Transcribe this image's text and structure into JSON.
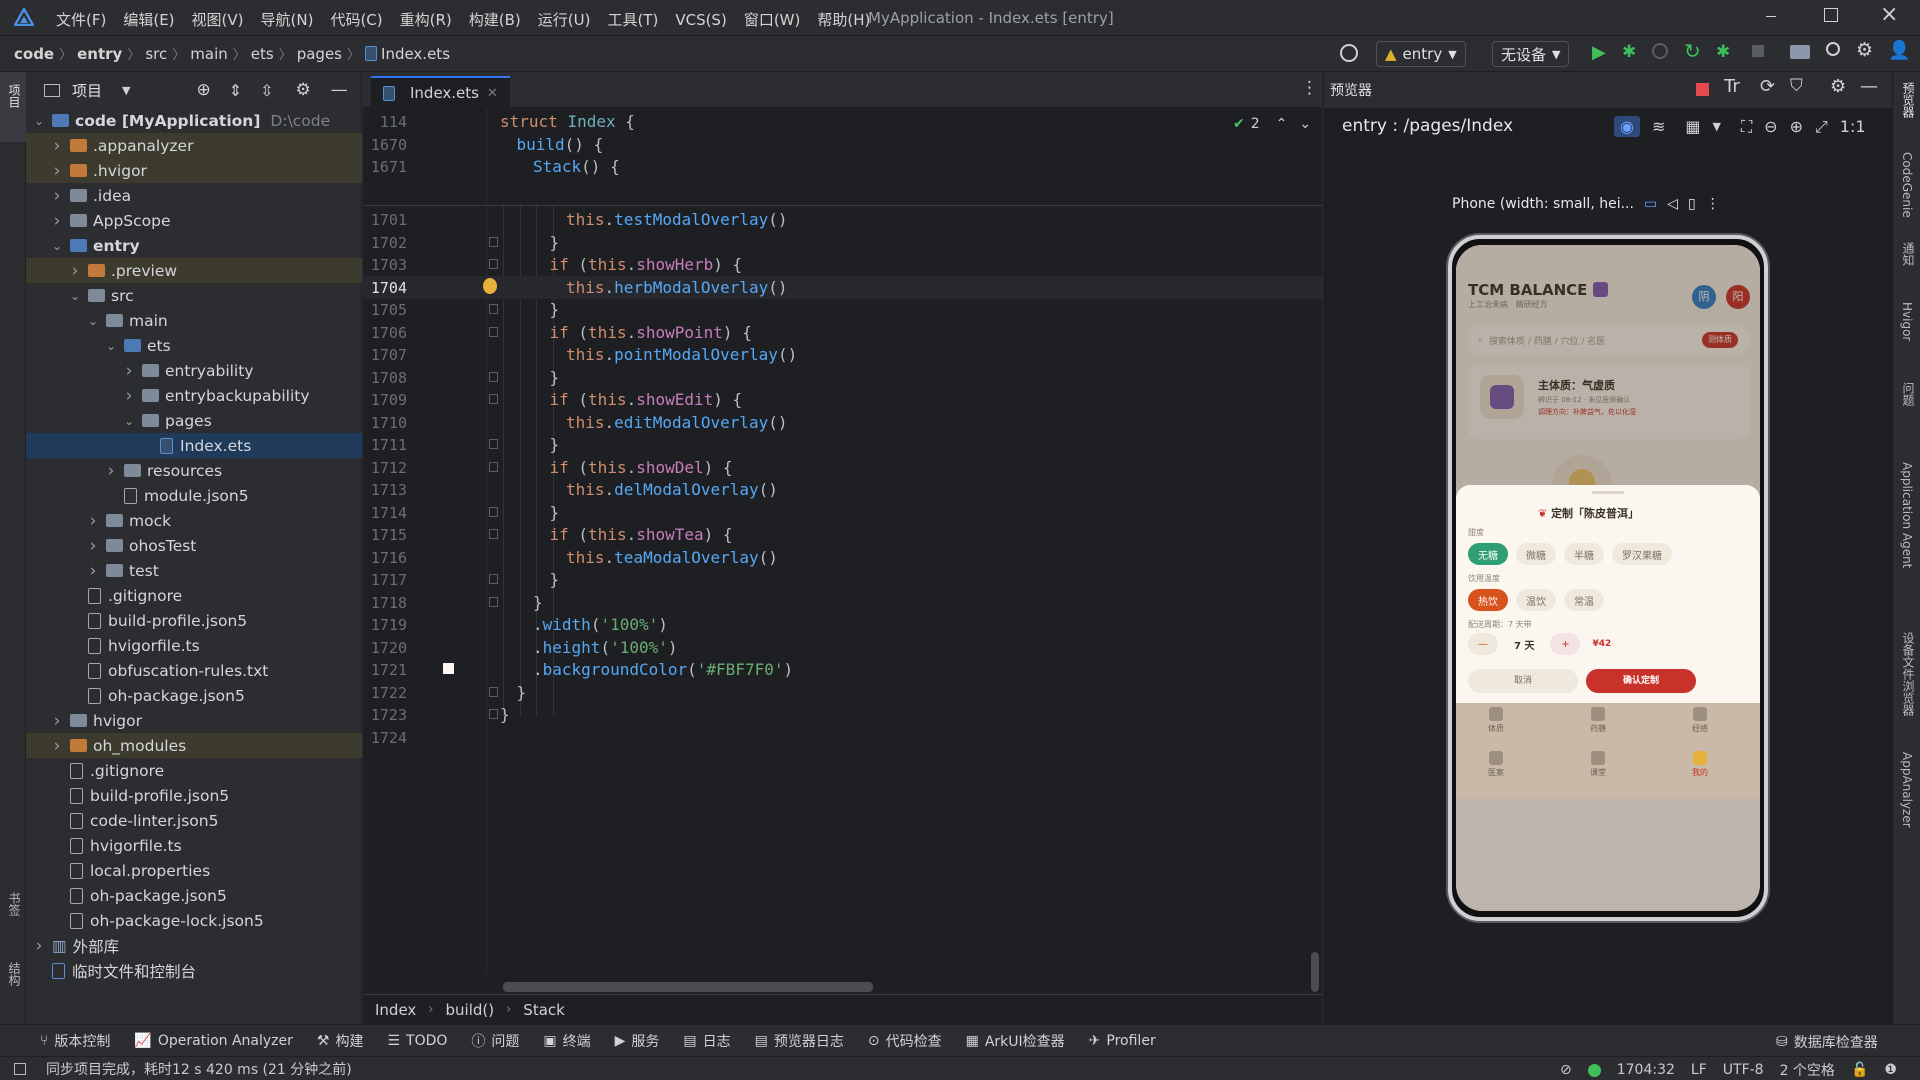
{
  "menu": [
    "文件(F)",
    "编辑(E)",
    "视图(V)",
    "导航(N)",
    "代码(C)",
    "重构(R)",
    "构建(B)",
    "运行(U)",
    "工具(T)",
    "VCS(S)",
    "窗口(W)",
    "帮助(H)"
  ],
  "window_title": "MyApplication - Index.ets [entry]",
  "breadcrumb": [
    "code",
    "entry",
    "src",
    "main",
    "ets",
    "pages",
    "Index.ets"
  ],
  "run_config": "entry",
  "device": "无设备",
  "left_strip": {
    "project": "项目",
    "bookmarks": "书签",
    "structure": "结构"
  },
  "project_panel": {
    "title": "项目"
  },
  "tree": [
    {
      "label": "code [MyApplication]",
      "extra": "D:\\code",
      "depth": 0,
      "arrow": "v",
      "type": "root",
      "bold": true
    },
    {
      "label": ".appanalyzer",
      "depth": 1,
      "arrow": ">",
      "type": "folder-orange",
      "hl": true
    },
    {
      "label": ".hvigor",
      "depth": 1,
      "arrow": ">",
      "type": "folder-orange",
      "hl": true
    },
    {
      "label": ".idea",
      "depth": 1,
      "arrow": ">",
      "type": "folder"
    },
    {
      "label": "AppScope",
      "depth": 1,
      "arrow": ">",
      "type": "folder"
    },
    {
      "label": "entry",
      "depth": 1,
      "arrow": "v",
      "type": "folder-blue",
      "bold": true
    },
    {
      "label": ".preview",
      "depth": 2,
      "arrow": ">",
      "type": "folder-orange",
      "hl": true
    },
    {
      "label": "src",
      "depth": 2,
      "arrow": "v",
      "type": "folder"
    },
    {
      "label": "main",
      "depth": 3,
      "arrow": "v",
      "type": "folder"
    },
    {
      "label": "ets",
      "depth": 4,
      "arrow": "v",
      "type": "folder-blue"
    },
    {
      "label": "entryability",
      "depth": 5,
      "arrow": ">",
      "type": "folder"
    },
    {
      "label": "entrybackupability",
      "depth": 5,
      "arrow": ">",
      "type": "folder"
    },
    {
      "label": "pages",
      "depth": 5,
      "arrow": "v",
      "type": "folder"
    },
    {
      "label": "Index.ets",
      "depth": 6,
      "arrow": "",
      "type": "ets",
      "sel": true
    },
    {
      "label": "resources",
      "depth": 4,
      "arrow": ">",
      "type": "folder"
    },
    {
      "label": "module.json5",
      "depth": 4,
      "arrow": "",
      "type": "file"
    },
    {
      "label": "mock",
      "depth": 3,
      "arrow": ">",
      "type": "folder"
    },
    {
      "label": "ohosTest",
      "depth": 3,
      "arrow": ">",
      "type": "folder"
    },
    {
      "label": "test",
      "depth": 3,
      "arrow": ">",
      "type": "folder"
    },
    {
      "label": ".gitignore",
      "depth": 2,
      "arrow": "",
      "type": "file"
    },
    {
      "label": "build-profile.json5",
      "depth": 2,
      "arrow": "",
      "type": "file"
    },
    {
      "label": "hvigorfile.ts",
      "depth": 2,
      "arrow": "",
      "type": "file"
    },
    {
      "label": "obfuscation-rules.txt",
      "depth": 2,
      "arrow": "",
      "type": "file"
    },
    {
      "label": "oh-package.json5",
      "depth": 2,
      "arrow": "",
      "type": "file"
    },
    {
      "label": "hvigor",
      "depth": 1,
      "arrow": ">",
      "type": "folder"
    },
    {
      "label": "oh_modules",
      "depth": 1,
      "arrow": ">",
      "type": "folder-orange",
      "hl": true
    },
    {
      "label": ".gitignore",
      "depth": 1,
      "arrow": "",
      "type": "file"
    },
    {
      "label": "build-profile.json5",
      "depth": 1,
      "arrow": "",
      "type": "file"
    },
    {
      "label": "code-linter.json5",
      "depth": 1,
      "arrow": "",
      "type": "file"
    },
    {
      "label": "hvigorfile.ts",
      "depth": 1,
      "arrow": "",
      "type": "file"
    },
    {
      "label": "local.properties",
      "depth": 1,
      "arrow": "",
      "type": "file"
    },
    {
      "label": "oh-package.json5",
      "depth": 1,
      "arrow": "",
      "type": "file"
    },
    {
      "label": "oh-package-lock.json5",
      "depth": 1,
      "arrow": "",
      "type": "file"
    },
    {
      "label": "外部库",
      "depth": 0,
      "arrow": ">",
      "type": "lib"
    },
    {
      "label": "临时文件和控制台",
      "depth": 0,
      "arrow": "",
      "type": "scratch"
    }
  ],
  "editor": {
    "tab": "Index.ets",
    "inspections": "2",
    "sticky": [
      {
        "ln": "114",
        "parts": [
          [
            "kw",
            "struct "
          ],
          [
            "ty",
            "Index "
          ],
          [
            "",
            "{"
          ]
        ],
        "indent": 0
      },
      {
        "ln": "1670",
        "parts": [
          [
            "fn",
            "build"
          ],
          [
            "",
            "() {"
          ]
        ],
        "indent": 1
      },
      {
        "ln": "1671",
        "parts": [
          [
            "fn",
            "Stack"
          ],
          [
            "",
            "() {"
          ]
        ],
        "indent": 2
      }
    ],
    "lines": [
      {
        "ln": "1701",
        "parts": [
          [
            "th",
            "this"
          ],
          [
            "",
            "."
          ],
          [
            "fn",
            "testModalOverlay"
          ],
          [
            "",
            "()"
          ]
        ],
        "indent": 4
      },
      {
        "ln": "1702",
        "parts": [
          [
            "",
            "}"
          ]
        ],
        "indent": 3
      },
      {
        "ln": "1703",
        "parts": [
          [
            "kw",
            "if "
          ],
          [
            "",
            "("
          ],
          [
            "th",
            "this"
          ],
          [
            "",
            "."
          ],
          [
            "pr",
            "showHerb"
          ],
          [
            "",
            ") {"
          ]
        ],
        "indent": 3
      },
      {
        "ln": "1704",
        "parts": [
          [
            "th",
            "this"
          ],
          [
            "",
            "."
          ],
          [
            "fn",
            "herbModalOverlay"
          ],
          [
            "",
            "()"
          ]
        ],
        "indent": 4,
        "current": true
      },
      {
        "ln": "1705",
        "parts": [
          [
            "",
            "}"
          ]
        ],
        "indent": 3
      },
      {
        "ln": "1706",
        "parts": [
          [
            "kw",
            "if "
          ],
          [
            "",
            "("
          ],
          [
            "th",
            "this"
          ],
          [
            "",
            "."
          ],
          [
            "pr",
            "showPoint"
          ],
          [
            "",
            ") {"
          ]
        ],
        "indent": 3
      },
      {
        "ln": "1707",
        "parts": [
          [
            "th",
            "this"
          ],
          [
            "",
            "."
          ],
          [
            "fn",
            "pointModalOverlay"
          ],
          [
            "",
            "()"
          ]
        ],
        "indent": 4
      },
      {
        "ln": "1708",
        "parts": [
          [
            "",
            "}"
          ]
        ],
        "indent": 3
      },
      {
        "ln": "1709",
        "parts": [
          [
            "kw",
            "if "
          ],
          [
            "",
            "("
          ],
          [
            "th",
            "this"
          ],
          [
            "",
            "."
          ],
          [
            "pr",
            "showEdit"
          ],
          [
            "",
            ") {"
          ]
        ],
        "indent": 3
      },
      {
        "ln": "1710",
        "parts": [
          [
            "th",
            "this"
          ],
          [
            "",
            "."
          ],
          [
            "fn",
            "editModalOverlay"
          ],
          [
            "",
            "()"
          ]
        ],
        "indent": 4
      },
      {
        "ln": "1711",
        "parts": [
          [
            "",
            "}"
          ]
        ],
        "indent": 3
      },
      {
        "ln": "1712",
        "parts": [
          [
            "kw",
            "if "
          ],
          [
            "",
            "("
          ],
          [
            "th",
            "this"
          ],
          [
            "",
            "."
          ],
          [
            "pr",
            "showDel"
          ],
          [
            "",
            ") {"
          ]
        ],
        "indent": 3
      },
      {
        "ln": "1713",
        "parts": [
          [
            "th",
            "this"
          ],
          [
            "",
            "."
          ],
          [
            "fn",
            "delModalOverlay"
          ],
          [
            "",
            "()"
          ]
        ],
        "indent": 4
      },
      {
        "ln": "1714",
        "parts": [
          [
            "",
            "}"
          ]
        ],
        "indent": 3
      },
      {
        "ln": "1715",
        "parts": [
          [
            "kw",
            "if "
          ],
          [
            "",
            "("
          ],
          [
            "th",
            "this"
          ],
          [
            "",
            "."
          ],
          [
            "pr",
            "showTea"
          ],
          [
            "",
            ") {"
          ]
        ],
        "indent": 3
      },
      {
        "ln": "1716",
        "parts": [
          [
            "th",
            "this"
          ],
          [
            "",
            "."
          ],
          [
            "fn",
            "teaModalOverlay"
          ],
          [
            "",
            "()"
          ]
        ],
        "indent": 4
      },
      {
        "ln": "1717",
        "parts": [
          [
            "",
            "}"
          ]
        ],
        "indent": 3
      },
      {
        "ln": "1718",
        "parts": [
          [
            "",
            "}"
          ]
        ],
        "indent": 2
      },
      {
        "ln": "1719",
        "parts": [
          [
            "",
            "."
          ],
          [
            "fn",
            "width"
          ],
          [
            "",
            "("
          ],
          [
            "str",
            "'100%'"
          ],
          [
            "",
            ")"
          ]
        ],
        "indent": 2
      },
      {
        "ln": "1720",
        "parts": [
          [
            "",
            "."
          ],
          [
            "fn",
            "height"
          ],
          [
            "",
            "("
          ],
          [
            "str",
            "'100%'"
          ],
          [
            "",
            ")"
          ]
        ],
        "indent": 2
      },
      {
        "ln": "1721",
        "parts": [
          [
            "",
            "."
          ],
          [
            "fn",
            "backgroundColor"
          ],
          [
            "",
            "("
          ],
          [
            "str",
            "'#FBF7F0'"
          ],
          [
            "",
            ")"
          ]
        ],
        "indent": 2
      },
      {
        "ln": "1722",
        "parts": [
          [
            "",
            "}"
          ]
        ],
        "indent": 1
      },
      {
        "ln": "1723",
        "parts": [
          [
            "",
            "}"
          ]
        ],
        "indent": 0
      },
      {
        "ln": "1724",
        "parts": [],
        "indent": 0
      }
    ],
    "breadcrumbs": [
      "Index",
      "build()",
      "Stack"
    ]
  },
  "preview": {
    "title": "预览器",
    "route": "entry : /pages/Index",
    "device_label": "Phone (width: small, hei...",
    "app": {
      "title": "TCM BALANCE",
      "subtitle": "上工治未病 · 精研经方",
      "yin": "阴",
      "yang": "阳",
      "search_placeholder": "搜索体质 / 药膳 / 穴位 / 名医",
      "search_btn": "测体质",
      "constitution_title": "主体质：气虚质",
      "constitution_line1": "辨识于 08-12 · 未见医师确认",
      "constitution_line2": "调理方向：补脾益气，佐以化湿",
      "modal_title": "定制「陈皮普洱」",
      "sweet_label": "甜度",
      "sweet_opts": [
        "无糖",
        "微糖",
        "半糖",
        "罗汉果糖"
      ],
      "temp_label": "饮用温度",
      "temp_opts": [
        "热饮",
        "温饮",
        "常温"
      ],
      "cycle_label": "配送周期：7 天带",
      "minus": "—",
      "days": "7 天",
      "plus": "+",
      "price": "¥42",
      "cancel": "取消",
      "confirm": "确认定制",
      "nav": [
        "体质",
        "药膳",
        "经络",
        "医案",
        "课堂",
        "我的"
      ]
    },
    "colors": {
      "green": "#2f9e72",
      "orange": "#d7531e",
      "red": "#c8322a",
      "blue": "#2f7ec4"
    }
  },
  "right_strip": [
    "预览器",
    "CodeGenie",
    "通知",
    "Hvigor",
    "问题",
    "Application Agent",
    "设备文件浏览器",
    "AppAnalyzer"
  ],
  "bottom_tools": [
    "版本控制",
    "Operation Analyzer",
    "构建",
    "TODO",
    "问题",
    "终端",
    "服务",
    "日志",
    "预览器日志",
    "代码检查",
    "ArkUI检查器",
    "Profiler"
  ],
  "db_inspector": "数据库检查器",
  "status": {
    "message": "同步项目完成，耗时12 s 420 ms (21 分钟之前)",
    "position": "1704:32",
    "line_sep": "LF",
    "encoding": "UTF-8",
    "indent": "2 个空格"
  }
}
